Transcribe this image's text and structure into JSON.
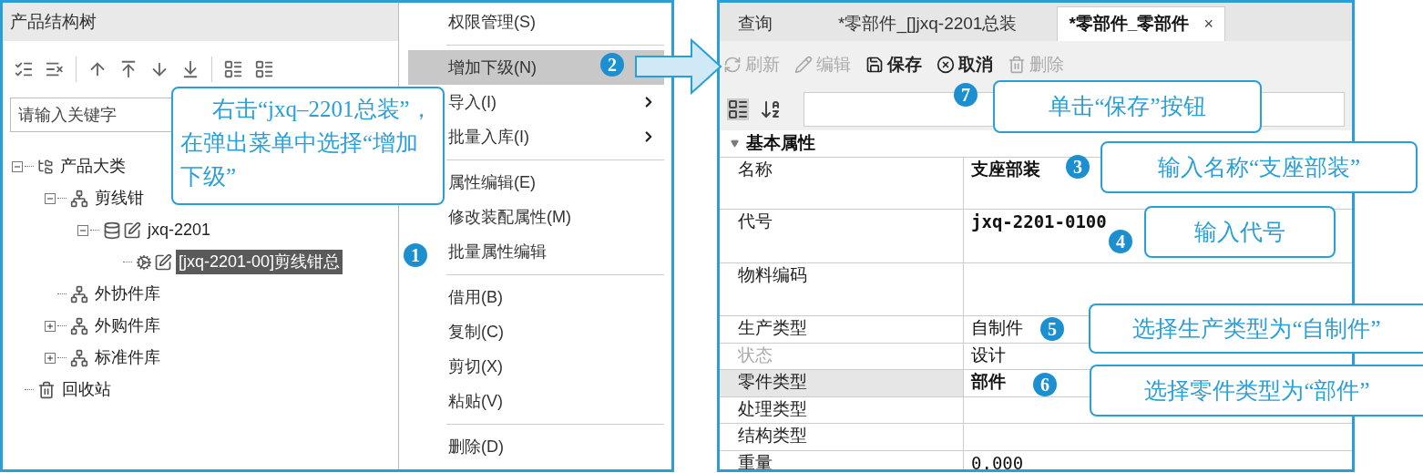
{
  "tree_panel": {
    "title": "产品结构树",
    "search": {
      "placeholder": "请输入关键字"
    },
    "tree": [
      {
        "label": "产品大类",
        "kind": "category",
        "selected": false,
        "expanded": true,
        "children": [
          {
            "label": "剪线钳",
            "kind": "library",
            "selected": false,
            "expanded": true,
            "children": [
              {
                "label": "jxq-2201",
                "kind": "part",
                "selected": false,
                "expanded": true,
                "children": [
                  {
                    "label": "[jxq-2201-00]剪线钳总",
                    "kind": "assembly",
                    "selected": true
                  }
                ]
              }
            ]
          },
          {
            "label": "外协件库",
            "kind": "library",
            "selected": false
          },
          {
            "label": "外购件库",
            "kind": "library",
            "selected": false,
            "expanded": false
          },
          {
            "label": "标准件库",
            "kind": "library",
            "selected": false,
            "expanded": false
          }
        ]
      },
      {
        "label": "回收站",
        "kind": "trash",
        "selected": false
      }
    ]
  },
  "context_menu": [
    {
      "kind": "item",
      "label": "权限管理(S)",
      "selected": false
    },
    {
      "kind": "separator"
    },
    {
      "kind": "item",
      "label": "增加下级(N)",
      "selected": true
    },
    {
      "kind": "item",
      "label": "导入(I)",
      "selected": false,
      "submenu": true
    },
    {
      "kind": "item",
      "label": "批量入库(I)",
      "selected": false,
      "submenu": true
    },
    {
      "kind": "separator"
    },
    {
      "kind": "item",
      "label": "属性编辑(E)",
      "selected": false
    },
    {
      "kind": "item",
      "label": "修改装配属性(M)",
      "selected": false
    },
    {
      "kind": "item",
      "label": "批量属性编辑",
      "selected": false
    },
    {
      "kind": "separator"
    },
    {
      "kind": "item",
      "label": "借用(B)",
      "selected": false
    },
    {
      "kind": "item",
      "label": "复制(C)",
      "selected": false
    },
    {
      "kind": "item",
      "label": "剪切(X)",
      "selected": false
    },
    {
      "kind": "item",
      "label": "粘贴(V)",
      "selected": false
    },
    {
      "kind": "separator"
    },
    {
      "kind": "item",
      "label": "删除(D)",
      "selected": false
    }
  ],
  "editor": {
    "tabs": [
      {
        "label": "查询",
        "selected": false
      },
      {
        "label": "*零部件_[]jxq-2201总装",
        "selected": false
      },
      {
        "label": "*零部件_零部件",
        "selected": true,
        "close": "×"
      }
    ],
    "toolbar": [
      {
        "kind": "refresh",
        "label": "刷新",
        "disabled": true
      },
      {
        "kind": "edit",
        "label": "编辑",
        "disabled": true
      },
      {
        "kind": "save",
        "label": "保存",
        "disabled": false
      },
      {
        "kind": "cancel",
        "label": "取消",
        "disabled": false
      },
      {
        "kind": "delete",
        "label": "删除",
        "disabled": true
      }
    ],
    "category": {
      "label": "基本属性",
      "expanded": true
    },
    "properties": [
      {
        "label": "名称",
        "value": "支座部装",
        "kind": "text",
        "bold": true,
        "disabled": false,
        "selected": false
      },
      {
        "label": "代号",
        "value": "jxq-2201-0100",
        "kind": "code",
        "bold": true,
        "disabled": false,
        "selected": false
      },
      {
        "label": "物料编码",
        "disabled": false,
        "selected": false
      },
      {
        "label": "生产类型",
        "value": "自制件",
        "kind": "text",
        "bold": false,
        "disabled": false,
        "selected": false
      },
      {
        "label": "状态",
        "value": "设计",
        "kind": "text",
        "bold": false,
        "disabled": true,
        "selected": false
      },
      {
        "label": "零件类型",
        "value": "部件",
        "kind": "text",
        "bold": true,
        "disabled": false,
        "selected": true
      },
      {
        "label": "处理类型",
        "disabled": false,
        "selected": false
      },
      {
        "label": "结构类型",
        "disabled": false,
        "selected": false
      },
      {
        "label": "重量",
        "value": "0.000",
        "kind": "code",
        "bold": false,
        "disabled": false,
        "selected": false
      }
    ]
  },
  "callouts": [
    {
      "number": "1",
      "text": "右击“jxq–2201总装”，在弹出菜单中选择“增加下级”"
    },
    {
      "number": "2"
    },
    {
      "number": "3",
      "text": "输入名称“支座部装”"
    },
    {
      "number": "4",
      "text": "输入代号"
    },
    {
      "number": "5",
      "text": "选择生产类型为“自制件”"
    },
    {
      "number": "6",
      "text": "选择零件类型为“部件”"
    },
    {
      "number": "7",
      "text": "单击“保存”按钮"
    }
  ]
}
